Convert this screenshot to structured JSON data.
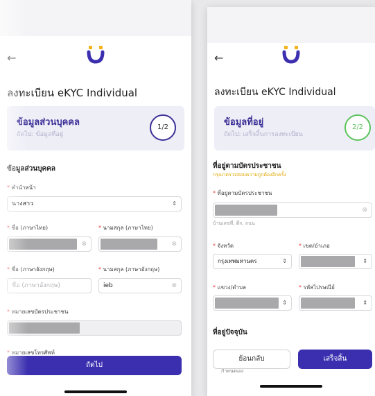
{
  "left": {
    "title": "ลงทะเบียน eKYC Individual",
    "step": {
      "title": "ข้อมูลส่วนบุคคล",
      "next": "ถัดไป: ข้อมูลที่อยู่",
      "progress": "1/2"
    },
    "section": "ข้อมูลส่วนบุคคล",
    "prefix": {
      "label": "คำนำหน้า",
      "value": "นางสาว"
    },
    "first_name_th": {
      "label": "ชื่อ (ภาษาไทย)"
    },
    "last_name_th": {
      "label": "นามสกุล (ภาษาไทย)"
    },
    "first_name_en": {
      "label": "ชื่อ (ภาษาอังกฤษ)",
      "placeholder": "ชื่อ (ภาษาอังกฤษ)"
    },
    "last_name_en": {
      "label": "นามสกุล (ภาษาอังกฤษ)",
      "value": "ieb"
    },
    "id_card": {
      "label": "หมายเลขบัตรประชาชน"
    },
    "phone": {
      "label": "หมายเลขโทรศัพท์"
    },
    "next_button": "ถัดไป"
  },
  "right": {
    "title": "ลงทะเบียน eKYC Individual",
    "step": {
      "title": "ข้อมูลที่อยู่",
      "next": "ถัดไป: เสร็จสิ้นการลงทะเบียน",
      "progress": "2/2"
    },
    "section": "ที่อยู่ตามบัตรประชาชน",
    "warning": "กรุณาตรวจสอบความถูกต้องอีกครั้ง",
    "address": {
      "label": "ที่อยู่ตามบัตรประชาชน",
      "hint": "บ้านเลขที่, ตึก, ถนน"
    },
    "province": {
      "label": "จังหวัด",
      "value": "กรุงเทพมหานคร"
    },
    "district": {
      "label": "เขต/อำเภอ"
    },
    "subdistrict": {
      "label": "แขวง/ตำบล"
    },
    "postal": {
      "label": "รหัสไปรษณีย์"
    },
    "current_section": "ที่อยู่ปัจจุบัน",
    "custom_option": "กำหนดเอง",
    "back_button": "ย้อนกลับ",
    "finish_button": "เสร็จสิ้น"
  },
  "colors": {
    "primary": "#3b2fb0",
    "accent_green": "#5cc35c",
    "required": "#e53935"
  },
  "icons": {
    "back": "arrow-left-icon",
    "logo": "u-logo-icon",
    "clear": "clear-icon",
    "chevron": "chevron-updown-icon"
  }
}
